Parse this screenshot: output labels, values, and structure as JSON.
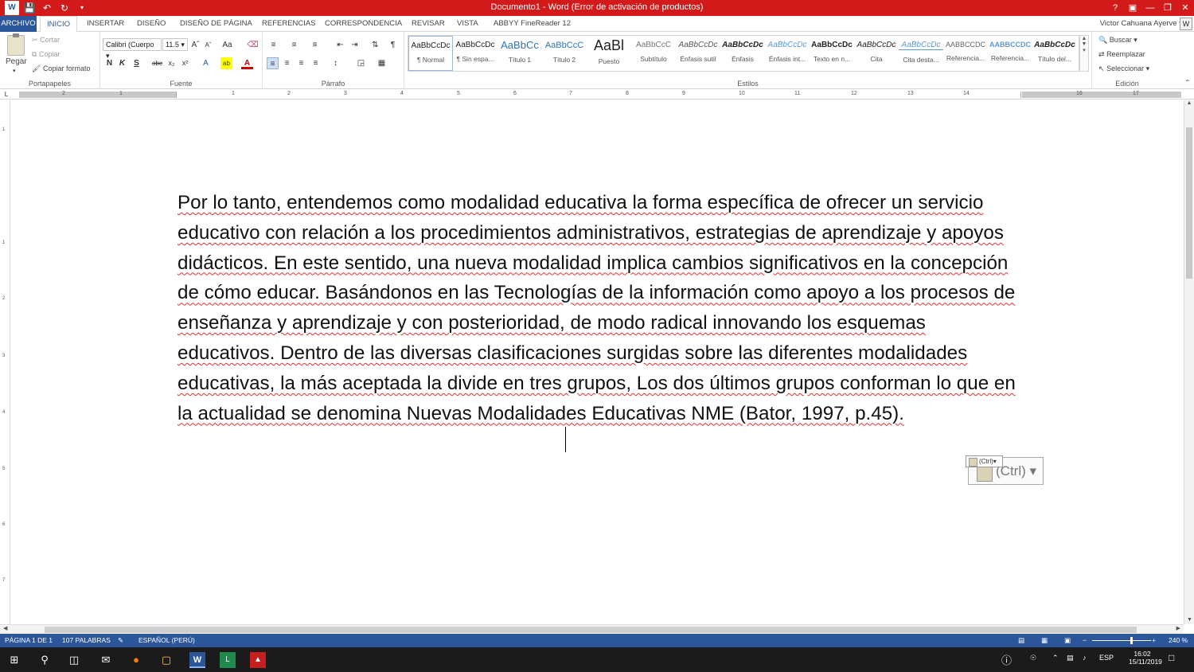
{
  "window": {
    "title": "Documento1 - Word (Error de activación de productos)"
  },
  "tabs": [
    "ARCHIVO",
    "INICIO",
    "INSERTAR",
    "DISEÑO",
    "DISEÑO DE PÁGINA",
    "REFERENCIAS",
    "CORRESPONDENCIA",
    "REVISAR",
    "VISTA",
    "ABBYY FineReader 12"
  ],
  "user": {
    "name": "Victor Cahuana Ayerve"
  },
  "clipboard": {
    "paste": "Pegar",
    "cut": "Cortar",
    "copy": "Copiar",
    "format_painter": "Copiar formato",
    "label": "Portapapeles"
  },
  "font": {
    "name": "Calibri (Cuerpo",
    "size": "11.5",
    "label": "Fuente"
  },
  "paragraph": {
    "label": "Párrafo"
  },
  "styles": {
    "label": "Estilos",
    "items": [
      {
        "preview": "AaBbCcDc",
        "name": "¶ Normal"
      },
      {
        "preview": "AaBbCcDc",
        "name": "¶ Sin espa..."
      },
      {
        "preview": "AaBbCc",
        "name": "Título 1"
      },
      {
        "preview": "AaBbCcC",
        "name": "Título 2"
      },
      {
        "preview": "AaBl",
        "name": "Puesto"
      },
      {
        "preview": "AaBbCcC",
        "name": "Subtítulo"
      },
      {
        "preview": "AaBbCcDc",
        "name": "Énfasis sutil"
      },
      {
        "preview": "AaBbCcDc",
        "name": "Énfasis"
      },
      {
        "preview": "AaBbCcDc",
        "name": "Énfasis int..."
      },
      {
        "preview": "AaBbCcDc",
        "name": "Texto en n..."
      },
      {
        "preview": "AaBbCcDc",
        "name": "Cita"
      },
      {
        "preview": "AaBbCcDc",
        "name": "Cita desta..."
      },
      {
        "preview": "AABBCCDC",
        "name": "Referencia..."
      },
      {
        "preview": "AABBCCDC",
        "name": "Referencia..."
      },
      {
        "preview": "AaBbCcDc",
        "name": "Título del..."
      }
    ]
  },
  "editing": {
    "find": "Buscar",
    "replace": "Reemplazar",
    "select": "Seleccionar",
    "label": "Edición"
  },
  "ruler": {
    "marks": [
      "2",
      "1",
      "1",
      "2",
      "3",
      "4",
      "5",
      "6",
      "7",
      "8",
      "9",
      "10",
      "11",
      "12",
      "13",
      "14",
      "16",
      "17"
    ]
  },
  "vruler": {
    "marks": [
      "1",
      "1",
      "2",
      "3",
      "4",
      "5",
      "6",
      "7"
    ]
  },
  "document": {
    "text": "Por lo tanto, entendemos como modalidad educativa la forma específica de ofrecer un servicio educativo con relación a los procedimientos administrativos, estrategias de aprendizaje y apoyos didácticos. En este sentido, una nueva modalidad implica cambios significativos en la concepción de cómo educar. Basándonos en las Tecnologías de la información como apoyo a los procesos de enseñanza y aprendizaje y con posterioridad, de modo radical innovando los esquemas educativos. Dentro de las diversas clasificaciones surgidas sobre las diferentes modalidades educativas, la más aceptada la divide en tres grupos, Los dos últimos grupos conforman lo que en la actualidad se denomina Nuevas Modalidades Educativas NME (Bator, 1997, p.45)."
  },
  "paste_options": {
    "big": "(Ctrl)",
    "small": "(Ctrl)"
  },
  "status": {
    "page": "PÁGINA 1 DE 1",
    "words": "107 PALABRAS",
    "language": "ESPAÑOL (PERÚ)",
    "zoom": "240 %"
  },
  "taskbar": {
    "lang": "ESP",
    "time": "16:02",
    "date": "15/11/2019"
  }
}
